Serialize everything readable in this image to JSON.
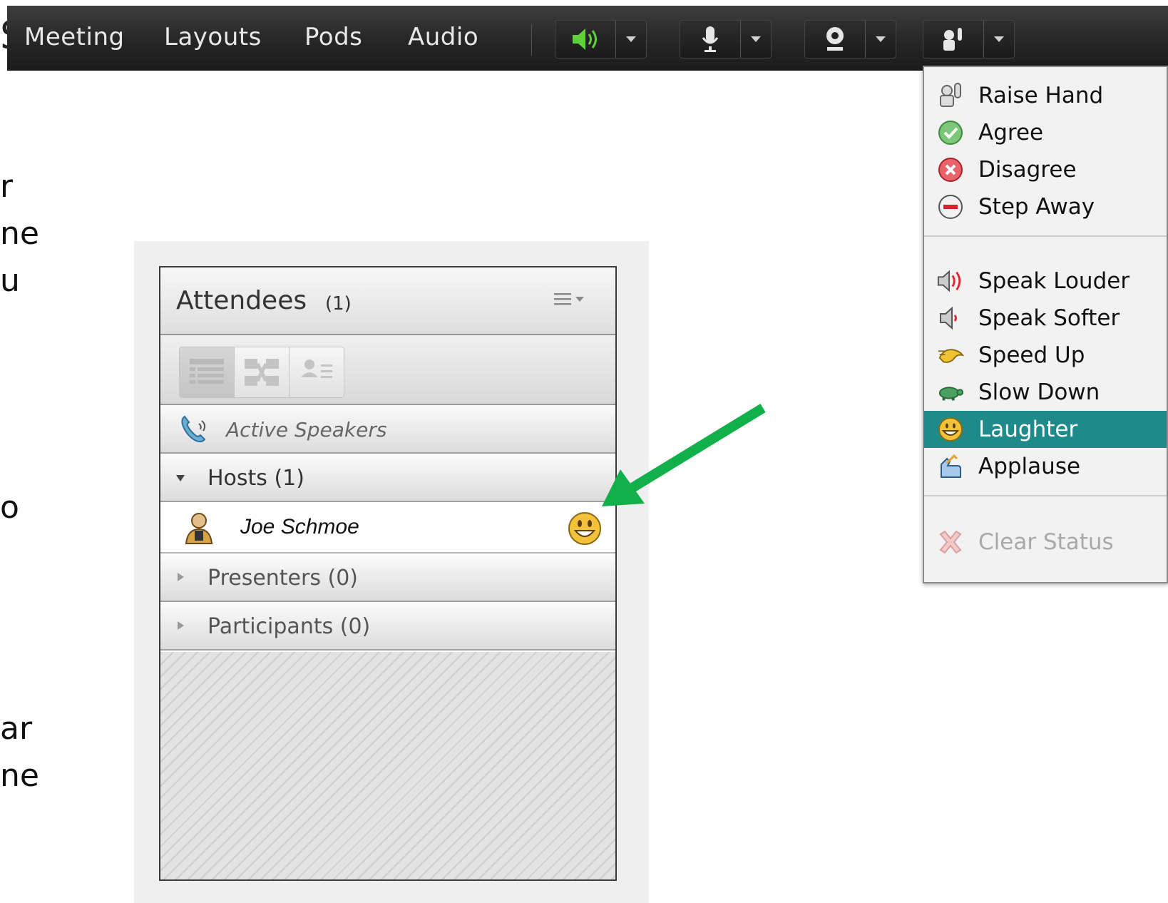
{
  "slide": {
    "title_fragment": "S",
    "text_fragments": [
      "r",
      "ne",
      "u",
      "o",
      "ar",
      "ne"
    ]
  },
  "menubar": {
    "items": [
      "Meeting",
      "Layouts",
      "Pods",
      "Audio"
    ],
    "tools": [
      {
        "icon": "speaker-icon",
        "state": "active"
      },
      {
        "icon": "microphone-icon"
      },
      {
        "icon": "webcam-icon"
      },
      {
        "icon": "raise-hand-status-icon"
      }
    ]
  },
  "attendees_pod": {
    "title": "Attendees",
    "count": "(1)",
    "active_speakers": "Active Speakers",
    "hosts": "Hosts (1)",
    "attendee": {
      "name": "Joe Schmoe",
      "status_icon": "laughter-icon"
    },
    "presenters": "Presenters (0)",
    "participants": "Participants (0)"
  },
  "status_menu": {
    "items": [
      {
        "label": "Raise Hand",
        "icon": "raise-hand-icon"
      },
      {
        "label": "Agree",
        "icon": "agree-icon"
      },
      {
        "label": "Disagree",
        "icon": "disagree-icon"
      },
      {
        "label": "Step Away",
        "icon": "step-away-icon"
      },
      {
        "label": "Speak Louder",
        "icon": "speak-louder-icon"
      },
      {
        "label": "Speak Softer",
        "icon": "speak-softer-icon"
      },
      {
        "label": "Speed Up",
        "icon": "speed-up-icon"
      },
      {
        "label": "Slow Down",
        "icon": "slow-down-icon"
      },
      {
        "label": "Laughter",
        "icon": "laughter-icon",
        "selected": true
      },
      {
        "label": "Applause",
        "icon": "applause-icon"
      },
      {
        "label": "Clear Status",
        "icon": "clear-status-icon",
        "disabled": true
      }
    ]
  },
  "colors": {
    "selected_highlight": "#1f8a8a",
    "arrow": "#12b04a",
    "speaker_active": "#5fd23a"
  }
}
